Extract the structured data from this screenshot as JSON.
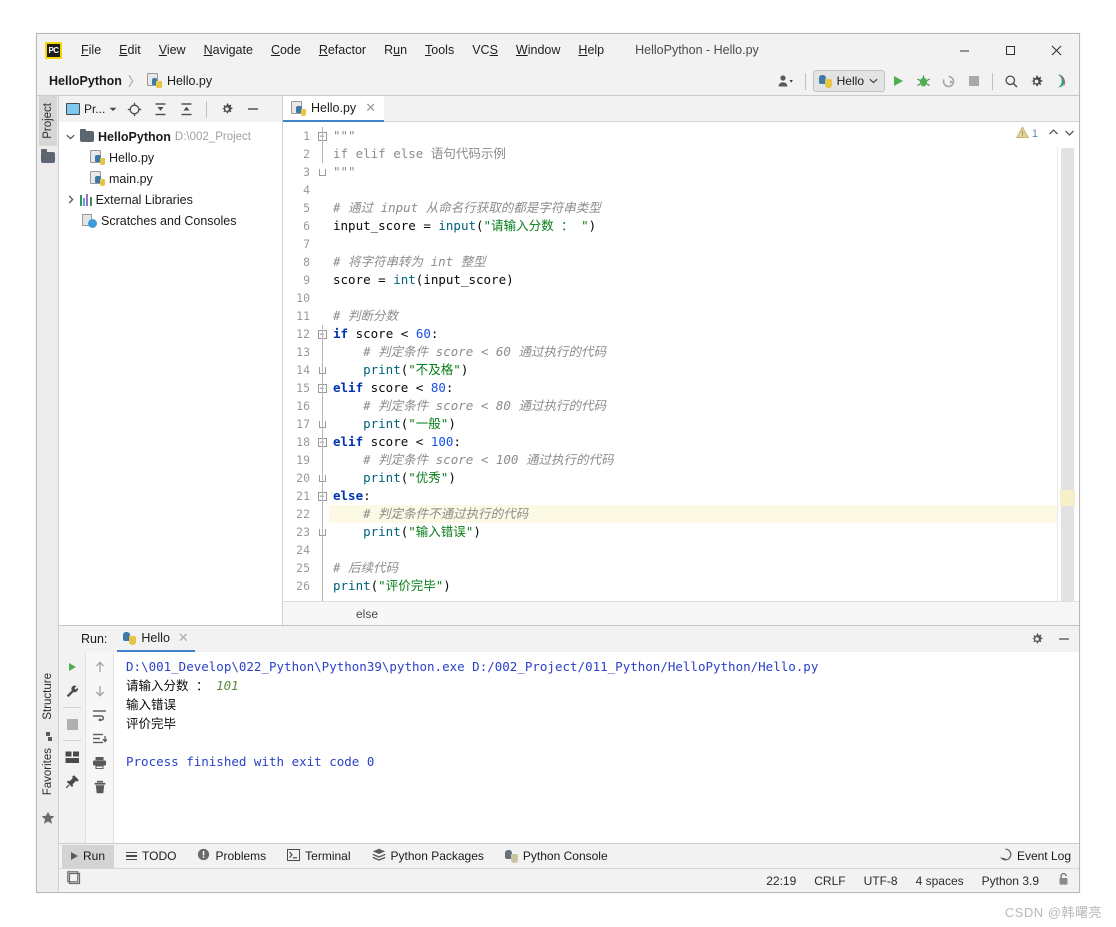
{
  "window": {
    "title": "HelloPython - Hello.py",
    "app_icon": "pycharm-logo-icon",
    "minimize_label": "—",
    "maximize_label": "□",
    "close_label": "✕"
  },
  "menu": {
    "items": [
      {
        "label": "File",
        "mnemonic": "F"
      },
      {
        "label": "Edit",
        "mnemonic": "E"
      },
      {
        "label": "View",
        "mnemonic": "V"
      },
      {
        "label": "Navigate",
        "mnemonic": "N"
      },
      {
        "label": "Code",
        "mnemonic": "C"
      },
      {
        "label": "Refactor",
        "mnemonic": "R"
      },
      {
        "label": "Run",
        "mnemonic": "u"
      },
      {
        "label": "Tools",
        "mnemonic": "T"
      },
      {
        "label": "VCS",
        "mnemonic": "S"
      },
      {
        "label": "Window",
        "mnemonic": "W"
      },
      {
        "label": "Help",
        "mnemonic": "H"
      }
    ]
  },
  "navbar": {
    "project_crumb": "HelloPython",
    "separator": "〉",
    "file_crumb": "Hello.py",
    "run_config": "Hello",
    "run_config_caret": "⌄"
  },
  "project_panel": {
    "title": "Pr...",
    "tree": [
      {
        "label": "HelloPython",
        "path": "D:\\002_Project",
        "icon": "folder-icon",
        "arrow": "⌄",
        "depth": 0,
        "bold": true
      },
      {
        "label": "Hello.py",
        "path": "",
        "icon": "python-file-icon",
        "arrow": "",
        "depth": 1,
        "bold": false
      },
      {
        "label": "main.py",
        "path": "",
        "icon": "python-file-icon",
        "arrow": "",
        "depth": 1,
        "bold": false
      },
      {
        "label": "External Libraries",
        "path": "",
        "icon": "libraries-icon",
        "arrow": "›",
        "depth": 0,
        "bold": false
      },
      {
        "label": "Scratches and Consoles",
        "path": "",
        "icon": "scratches-icon",
        "arrow": "",
        "depth": 0,
        "bold": false
      }
    ]
  },
  "sidebar_tabs": {
    "project": "Project",
    "structure": "Structure",
    "favorites": "Favorites"
  },
  "editor": {
    "tab_label": "Hello.py",
    "tab_close": "✕",
    "warning_count": "1",
    "breadcrumb": "else",
    "lines": [
      {
        "n": 1,
        "fold": "start",
        "tokens": [
          {
            "t": "\"\"\"",
            "c": "d"
          }
        ]
      },
      {
        "n": 2,
        "fold": "",
        "tokens": [
          {
            "t": "if elif else 语句代码示例",
            "c": "d"
          }
        ]
      },
      {
        "n": 3,
        "fold": "end",
        "tokens": [
          {
            "t": "\"\"\"",
            "c": "d"
          }
        ]
      },
      {
        "n": 4,
        "fold": "",
        "tokens": []
      },
      {
        "n": 5,
        "fold": "",
        "tokens": [
          {
            "t": "# 通过 input 从命名行获取的都是字符串类型",
            "c": "c"
          }
        ]
      },
      {
        "n": 6,
        "fold": "",
        "tokens": [
          {
            "t": "input_score ",
            "c": "p"
          },
          {
            "t": "= ",
            "c": "p"
          },
          {
            "t": "input",
            "c": "fn"
          },
          {
            "t": "(",
            "c": "p"
          },
          {
            "t": "\"请输入分数 ： \"",
            "c": "s"
          },
          {
            "t": ")",
            "c": "p"
          }
        ]
      },
      {
        "n": 7,
        "fold": "",
        "tokens": []
      },
      {
        "n": 8,
        "fold": "",
        "tokens": [
          {
            "t": "# 将字符串转为 int 整型",
            "c": "c"
          }
        ]
      },
      {
        "n": 9,
        "fold": "",
        "tokens": [
          {
            "t": "score ",
            "c": "p"
          },
          {
            "t": "= ",
            "c": "p"
          },
          {
            "t": "int",
            "c": "fn"
          },
          {
            "t": "(input_score)",
            "c": "p"
          }
        ]
      },
      {
        "n": 10,
        "fold": "",
        "tokens": []
      },
      {
        "n": 11,
        "fold": "",
        "tokens": [
          {
            "t": "# 判断分数",
            "c": "c"
          }
        ]
      },
      {
        "n": 12,
        "fold": "start",
        "tokens": [
          {
            "t": "if",
            "c": "k"
          },
          {
            "t": " score ",
            "c": "p"
          },
          {
            "t": "< ",
            "c": "p"
          },
          {
            "t": "60",
            "c": "n"
          },
          {
            "t": ":",
            "c": "p"
          }
        ]
      },
      {
        "n": 13,
        "fold": "",
        "tokens": [
          {
            "t": "    # 判定条件 score < 60 通过执行的代码",
            "c": "c"
          }
        ]
      },
      {
        "n": 14,
        "fold": "end",
        "tokens": [
          {
            "t": "    ",
            "c": "p"
          },
          {
            "t": "print",
            "c": "fn"
          },
          {
            "t": "(",
            "c": "p"
          },
          {
            "t": "\"不及格\"",
            "c": "s"
          },
          {
            "t": ")",
            "c": "p"
          }
        ]
      },
      {
        "n": 15,
        "fold": "start",
        "tokens": [
          {
            "t": "elif",
            "c": "k"
          },
          {
            "t": " score ",
            "c": "p"
          },
          {
            "t": "< ",
            "c": "p"
          },
          {
            "t": "80",
            "c": "n"
          },
          {
            "t": ":",
            "c": "p"
          }
        ]
      },
      {
        "n": 16,
        "fold": "",
        "tokens": [
          {
            "t": "    # 判定条件 score < 80 通过执行的代码",
            "c": "c"
          }
        ]
      },
      {
        "n": 17,
        "fold": "end",
        "tokens": [
          {
            "t": "    ",
            "c": "p"
          },
          {
            "t": "print",
            "c": "fn"
          },
          {
            "t": "(",
            "c": "p"
          },
          {
            "t": "\"一般\"",
            "c": "s"
          },
          {
            "t": ")",
            "c": "p"
          }
        ]
      },
      {
        "n": 18,
        "fold": "start",
        "tokens": [
          {
            "t": "elif",
            "c": "k"
          },
          {
            "t": " score ",
            "c": "p"
          },
          {
            "t": "< ",
            "c": "p"
          },
          {
            "t": "100",
            "c": "n"
          },
          {
            "t": ":",
            "c": "p"
          }
        ]
      },
      {
        "n": 19,
        "fold": "",
        "tokens": [
          {
            "t": "    # 判定条件 score < 100 通过执行的代码",
            "c": "c"
          }
        ]
      },
      {
        "n": 20,
        "fold": "end",
        "tokens": [
          {
            "t": "    ",
            "c": "p"
          },
          {
            "t": "print",
            "c": "fn"
          },
          {
            "t": "(",
            "c": "p"
          },
          {
            "t": "\"优秀\"",
            "c": "s"
          },
          {
            "t": ")",
            "c": "p"
          }
        ]
      },
      {
        "n": 21,
        "fold": "start",
        "tokens": [
          {
            "t": "else",
            "c": "k"
          },
          {
            "t": ":",
            "c": "p"
          }
        ]
      },
      {
        "n": 22,
        "fold": "",
        "highlight": true,
        "tokens": [
          {
            "t": "    # 判定条件不通过执行的代码",
            "c": "c"
          }
        ]
      },
      {
        "n": 23,
        "fold": "end",
        "tokens": [
          {
            "t": "    ",
            "c": "p"
          },
          {
            "t": "print",
            "c": "fn"
          },
          {
            "t": "(",
            "c": "p"
          },
          {
            "t": "\"输入错误\"",
            "c": "s"
          },
          {
            "t": ")",
            "c": "p"
          }
        ]
      },
      {
        "n": 24,
        "fold": "",
        "tokens": []
      },
      {
        "n": 25,
        "fold": "",
        "tokens": [
          {
            "t": "# 后续代码",
            "c": "c"
          }
        ]
      },
      {
        "n": 26,
        "fold": "",
        "tokens": [
          {
            "t": "print",
            "c": "fn"
          },
          {
            "t": "(",
            "c": "p"
          },
          {
            "t": "\"评价完毕\"",
            "c": "s"
          },
          {
            "t": ")",
            "c": "p"
          }
        ]
      }
    ]
  },
  "run_panel": {
    "label": "Run:",
    "tab_label": "Hello",
    "tab_close": "✕",
    "output": [
      {
        "text": "D:\\001_Develop\\022_Python\\Python39\\python.exe D:/002_Project/011_Python/HelloPython/Hello.py",
        "style": "out-blue"
      },
      {
        "text": "请输入分数 ： ",
        "style": "out-black",
        "suffix": "101",
        "suffix_style": "out-green"
      },
      {
        "text": "输入错误",
        "style": "out-black"
      },
      {
        "text": "评价完毕",
        "style": "out-black"
      },
      {
        "text": "",
        "style": "out-black"
      },
      {
        "text": "Process finished with exit code 0",
        "style": "out-blue"
      }
    ]
  },
  "bottom_tabs": [
    {
      "label": "Run",
      "icon": "run-icon",
      "active": true
    },
    {
      "label": "TODO",
      "icon": "todo-icon",
      "active": false
    },
    {
      "label": "Problems",
      "icon": "problems-icon",
      "active": false
    },
    {
      "label": "Terminal",
      "icon": "terminal-icon",
      "active": false
    },
    {
      "label": "Python Packages",
      "icon": "packages-icon",
      "active": false
    },
    {
      "label": "Python Console",
      "icon": "python-console-icon",
      "active": false
    }
  ],
  "event_log": {
    "label": "Event Log",
    "icon": "event-log-icon"
  },
  "statusbar": {
    "position": "22:19",
    "line_sep": "CRLF",
    "encoding": "UTF-8",
    "indent": "4 spaces",
    "interpreter": "Python 3.9",
    "lock_icon": "lock-icon"
  },
  "watermark": "CSDN @韩曙亮",
  "colors": {
    "accent": "#4083c9",
    "keyword": "#0033b3",
    "string": "#067d17",
    "number": "#1750eb",
    "comment": "#8c8c8c",
    "builtin": "#00627a",
    "run_green": "#4caf50",
    "highlight_line": "#fcf9e4"
  }
}
